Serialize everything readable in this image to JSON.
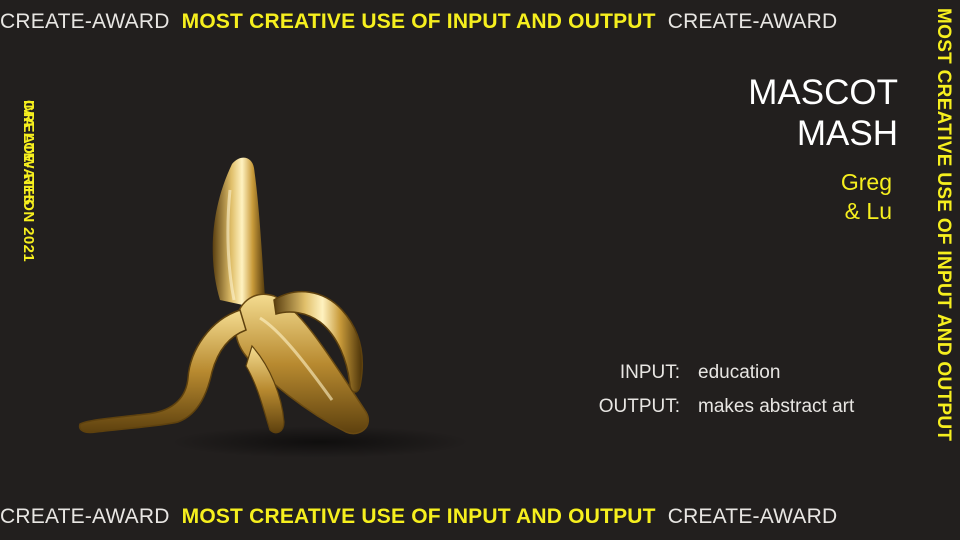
{
  "top_band": {
    "left_award": "CREATE-AWARD",
    "category": "MOST CREATIVE USE OF INPUT AND OUTPUT",
    "right_award": "CREATE-AWARD"
  },
  "bottom_band": {
    "left_award": "CREATE-AWARD",
    "category": "MOST CREATIVE USE OF INPUT AND OUTPUT",
    "right_award": "CREATE-AWARD"
  },
  "right_vertical": "MOST CREATIVE USE OF INPUT AND OUTPUT",
  "left_vertical": {
    "part1": "IMA LOW RES",
    "part2": "CREATE-ATHON 2021"
  },
  "project": {
    "title_line1": "MASCOT",
    "title_line2": "MASH",
    "author_line1": "Greg",
    "author_line2": "& Lu"
  },
  "io": {
    "input_label": "INPUT:",
    "input_value": "education",
    "output_label": "OUTPUT:",
    "output_value": "makes abstract art"
  },
  "image": {
    "icon": "golden-banana-sculpture",
    "gold": "#c9a24a",
    "accent": "#f6ef1e",
    "background": "#221f1e"
  }
}
